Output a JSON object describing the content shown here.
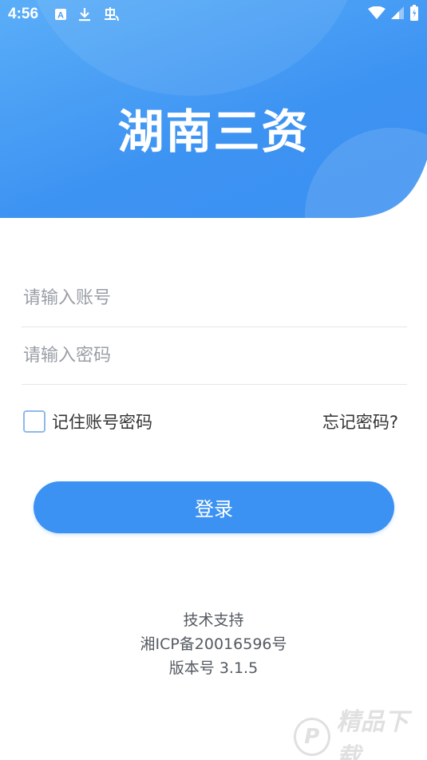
{
  "status_bar": {
    "time": "4:56",
    "icons_left": [
      "a-badge-icon",
      "download-icon",
      "bug-icon"
    ],
    "icons_right": [
      "wifi-icon",
      "signal-icon",
      "battery-icon"
    ]
  },
  "header": {
    "app_title": "湖南三资"
  },
  "form": {
    "account_placeholder": "请输入账号",
    "password_placeholder": "请输入密码",
    "remember_label": "记住账号密码",
    "forgot_label": "忘记密码?",
    "login_label": "登录"
  },
  "footer": {
    "tech_support": "技术支持",
    "icp": "湘ICP备20016596号",
    "version": "版本号 3.1.5"
  },
  "watermark": {
    "text": "精品下载",
    "logo_letter": "P"
  },
  "colors": {
    "primary": "#3c92f2",
    "header_light": "#5aaef8",
    "text": "#333333",
    "placeholder": "#9a9ea6"
  }
}
